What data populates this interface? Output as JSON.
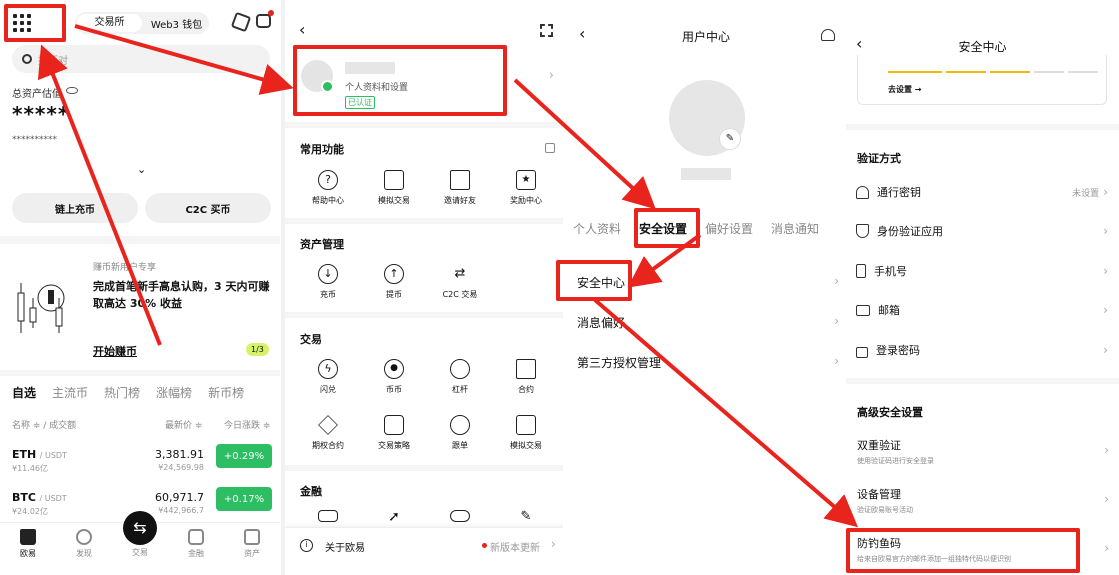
{
  "p1": {
    "tab_exchange": "交易所",
    "tab_web3": "Web3 钱包",
    "search_placeholder": "搜币对",
    "total_label": "总资产估值",
    "balance_mask": "*****",
    "balance_sub": "**********",
    "onchain_btn": "链上充币",
    "c2c_btn": "C2C 买币",
    "promo_small": "赚币新用户专享",
    "promo_text": "完成首笔新手高息认购，3 天内可赚取高达 30% 收益",
    "promo_cta": "开始赚币",
    "promo_page": "1/3",
    "market_tabs": [
      "自选",
      "主流币",
      "热门榜",
      "涨幅榜",
      "新币榜"
    ],
    "col_name": "名称 ≑ / 成交额",
    "col_price": "最新价 ≑",
    "col_change": "今日涨跌 ≑",
    "rows": [
      {
        "coin": "ETH",
        "quote": "/ USDT",
        "vol": "¥11.46亿",
        "price": "3,381.91",
        "cny": "¥24,569.98",
        "chg": "+0.29%"
      },
      {
        "coin": "BTC",
        "quote": "/ USDT",
        "vol": "¥24.02亿",
        "price": "60,971.7",
        "cny": "¥442,966.7",
        "chg": "+0.17%"
      }
    ],
    "nav": [
      "欧易",
      "发现",
      "交易",
      "金融",
      "资产"
    ]
  },
  "p2": {
    "profile_sub": "个人资料和设置",
    "verified": "已认证",
    "sec_common": "常用功能",
    "common": [
      "帮助中心",
      "模拟交易",
      "邀请好友",
      "奖励中心"
    ],
    "sec_asset": "资产管理",
    "asset": [
      "充币",
      "提币",
      "C2C 交易"
    ],
    "sec_trade": "交易",
    "trade1": [
      "闪兑",
      "币币",
      "杠杆",
      "合约"
    ],
    "trade2": [
      "期权合约",
      "交易策略",
      "跟单",
      "模拟交易"
    ],
    "sec_finance": "金融",
    "about": "关于欧易",
    "update": "新版本更新"
  },
  "p3": {
    "title": "用户中心",
    "tabs": [
      "个人资料",
      "安全设置",
      "偏好设置",
      "消息通知"
    ],
    "items": [
      "安全中心",
      "消息偏好",
      "第三方授权管理"
    ]
  },
  "p4": {
    "title": "安全中心",
    "set_link": "去设置 →",
    "verify_title": "验证方式",
    "verify": [
      {
        "label": "通行密钥",
        "right": "未设置"
      },
      {
        "label": "身份验证应用",
        "right": ""
      },
      {
        "label": "手机号",
        "right": ""
      },
      {
        "label": "邮箱",
        "right": ""
      },
      {
        "label": "登录密码",
        "right": ""
      }
    ],
    "adv_title": "高级安全设置",
    "adv": [
      {
        "label": "双重验证",
        "sub": "使用验证码进行安全登录"
      },
      {
        "label": "设备管理",
        "sub": "验证欧易账号活动"
      },
      {
        "label": "防钓鱼码",
        "sub": "给来自欧易官方的邮件添加一组独特代码以便识别"
      }
    ]
  },
  "colors": {
    "accent_red": "#e8241d",
    "green": "#2dbd63",
    "yellow": "#f0b90b"
  }
}
